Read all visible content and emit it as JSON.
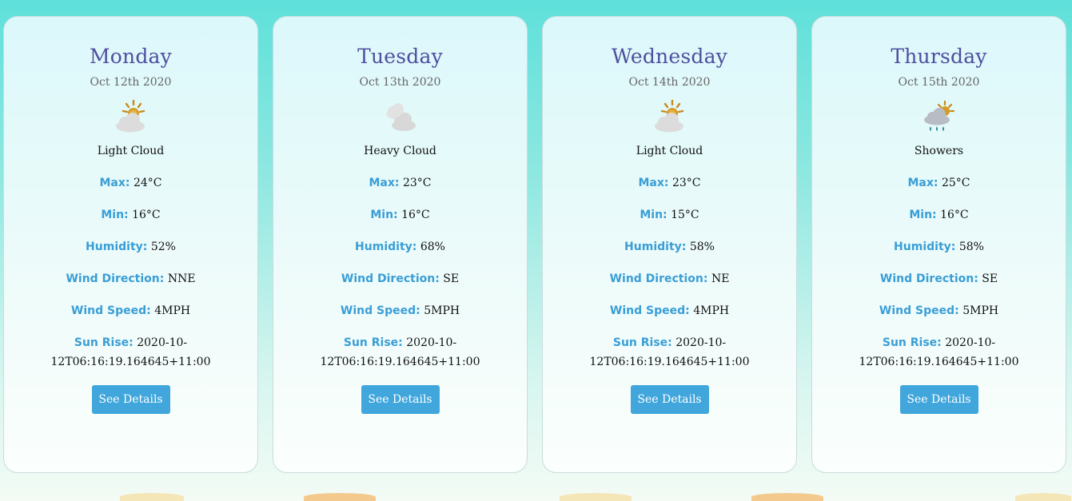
{
  "labels": {
    "max": "Max:",
    "min": "Min:",
    "humidity": "Humidity:",
    "wind_direction": "Wind Direction:",
    "wind_speed": "Wind Speed:",
    "sun_rise": "Sun Rise:",
    "details_button": "See Details"
  },
  "days": [
    {
      "day": "Monday",
      "date": "Oct 12th 2020",
      "icon": "sun-cloud-icon",
      "condition": "Light Cloud",
      "max": "24°C",
      "min": "16°C",
      "humidity": "52%",
      "wind_direction": "NNE",
      "wind_speed": "4MPH",
      "sun_rise": "2020-10-12T06:16:19.164645+11:00"
    },
    {
      "day": "Tuesday",
      "date": "Oct 13th 2020",
      "icon": "heavy-cloud-icon",
      "condition": "Heavy Cloud",
      "max": "23°C",
      "min": "16°C",
      "humidity": "68%",
      "wind_direction": "SE",
      "wind_speed": "5MPH",
      "sun_rise": "2020-10-12T06:16:19.164645+11:00"
    },
    {
      "day": "Wednesday",
      "date": "Oct 14th 2020",
      "icon": "sun-cloud-icon",
      "condition": "Light Cloud",
      "max": "23°C",
      "min": "15°C",
      "humidity": "58%",
      "wind_direction": "NE",
      "wind_speed": "4MPH",
      "sun_rise": "2020-10-12T06:16:19.164645+11:00"
    },
    {
      "day": "Thursday",
      "date": "Oct 15th 2020",
      "icon": "showers-icon",
      "condition": "Showers",
      "max": "25°C",
      "min": "16°C",
      "humidity": "58%",
      "wind_direction": "SE",
      "wind_speed": "5MPH",
      "sun_rise": "2020-10-12T06:16:19.164645+11:00"
    }
  ],
  "colors": {
    "day_title": "#4e4f9f",
    "label": "#3a9ed6",
    "button": "#40a6dc"
  }
}
